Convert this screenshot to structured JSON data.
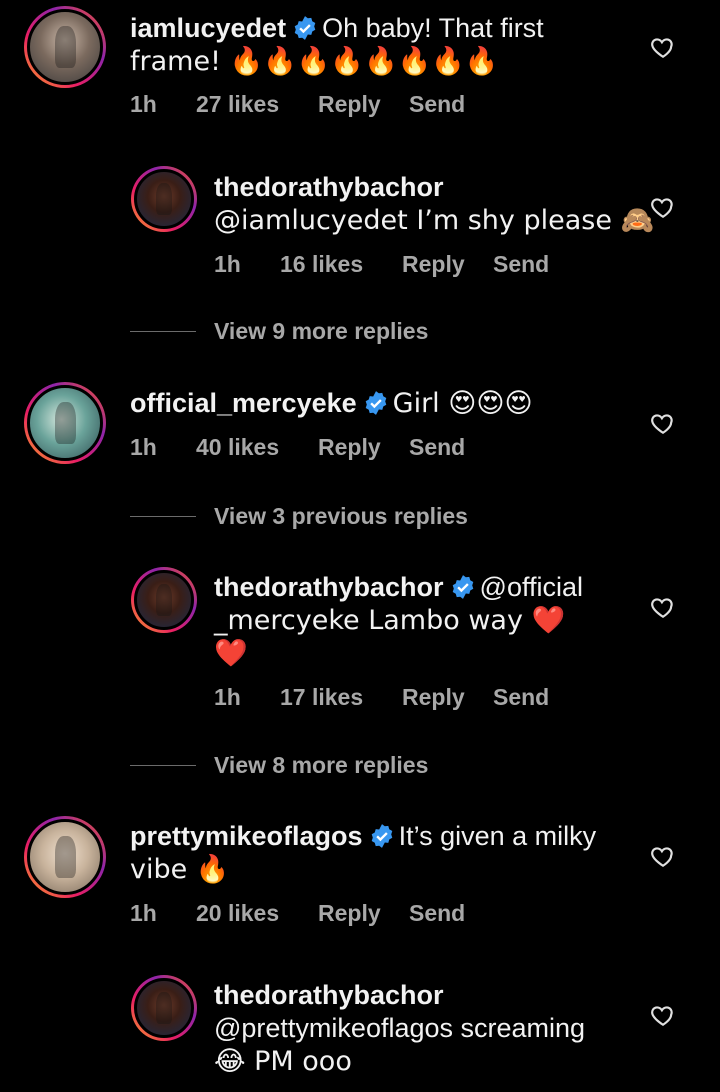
{
  "comments": [
    {
      "username": "iamlucyedet",
      "verified": true,
      "line1": "Oh baby! That first",
      "line2": "frame! 🔥🔥🔥🔥🔥🔥🔥🔥",
      "time": "1h",
      "likes": "27 likes",
      "reply": "Reply",
      "send": "Send"
    },
    {
      "username": "thedorathybachor",
      "verified": false,
      "line1": "@iamlucyedet I’m shy please 🙈",
      "time": "1h",
      "likes": "16 likes",
      "reply": "Reply",
      "send": "Send"
    },
    {
      "username": "official_mercyeke",
      "verified": true,
      "line1": "Girl 😍😍😍",
      "time": "1h",
      "likes": "40 likes",
      "reply": "Reply",
      "send": "Send"
    },
    {
      "username": "thedorathybachor",
      "verified": true,
      "line1": "@official",
      "line2": "_mercyeke Lambo way ❤️",
      "line3": "❤️",
      "time": "1h",
      "likes": "17 likes",
      "reply": "Reply",
      "send": "Send"
    },
    {
      "username": "prettymikeoflagos",
      "verified": true,
      "line1": "It’s given a milky",
      "line2": "vibe 🔥",
      "time": "1h",
      "likes": "20 likes",
      "reply": "Reply",
      "send": "Send"
    },
    {
      "username": "thedorathybachor",
      "verified": false,
      "line1": "@prettymikeoflagos screaming",
      "line2": "😂 PM ooo"
    }
  ],
  "view_replies": [
    "View 9 more replies",
    "View 3 previous replies",
    "View 8 more replies"
  ],
  "colors": {
    "background": "#000000",
    "text": "#f2f2f2",
    "meta": "#a8a8a8",
    "verified_blue": "#3897f0"
  }
}
